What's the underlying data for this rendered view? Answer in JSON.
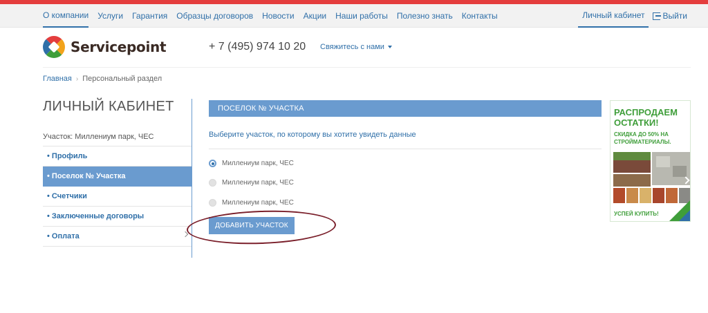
{
  "nav": {
    "items": [
      {
        "label": "О компании",
        "active": true
      },
      {
        "label": "Услуги"
      },
      {
        "label": "Гарантия"
      },
      {
        "label": "Образцы договоров"
      },
      {
        "label": "Новости"
      },
      {
        "label": "Акции"
      },
      {
        "label": "Наши работы"
      },
      {
        "label": "Полезно знать"
      },
      {
        "label": "Контакты"
      }
    ],
    "cabinet": "Личный кабинет",
    "logout": "Выйти"
  },
  "header": {
    "brand": "Servicepoint",
    "phone": "+ 7 (495) 974 10 20",
    "contact": "Свяжитесь с нами"
  },
  "breadcrumb": {
    "home": "Главная",
    "current": "Персональный раздел"
  },
  "sidebar": {
    "title": "ЛИЧНЫЙ КАБИНЕТ",
    "plot": "Участок: Миллениум парк, ЧЕС",
    "items": [
      {
        "label": "• Профиль"
      },
      {
        "label": "• Поселок № Участка",
        "active": true
      },
      {
        "label": "• Счетчики"
      },
      {
        "label": "• Заключенные договоры"
      },
      {
        "label": "• Оплата"
      }
    ]
  },
  "main": {
    "section_title": "ПОСЕЛОК № УЧАСТКА",
    "hint": "Выберите участок, по которому вы хотите увидеть данные",
    "options": [
      {
        "label": "Миллениум парк, ЧЕС",
        "checked": true
      },
      {
        "label": "Миллениум парк, ЧЕС",
        "checked": false
      },
      {
        "label": "Миллениум парк, ЧЕС",
        "checked": false
      }
    ],
    "add_button": "ДОБАВИТЬ УЧАСТОК"
  },
  "ad": {
    "title": "РАСПРОДАЕМ ОСТАТКИ!",
    "subtitle": "СКИДКА ДО 50% НА СТРОЙМАТЕРИАЛЫ.",
    "cta": "УСПЕЙ КУПИТЬ!"
  },
  "colors": {
    "accent": "#2f6fa8",
    "panel": "#6a9bcf",
    "top_stripe": "#e43d3d",
    "ad_green": "#3f9e3a",
    "annotation_ring": "#7a1f2a"
  }
}
